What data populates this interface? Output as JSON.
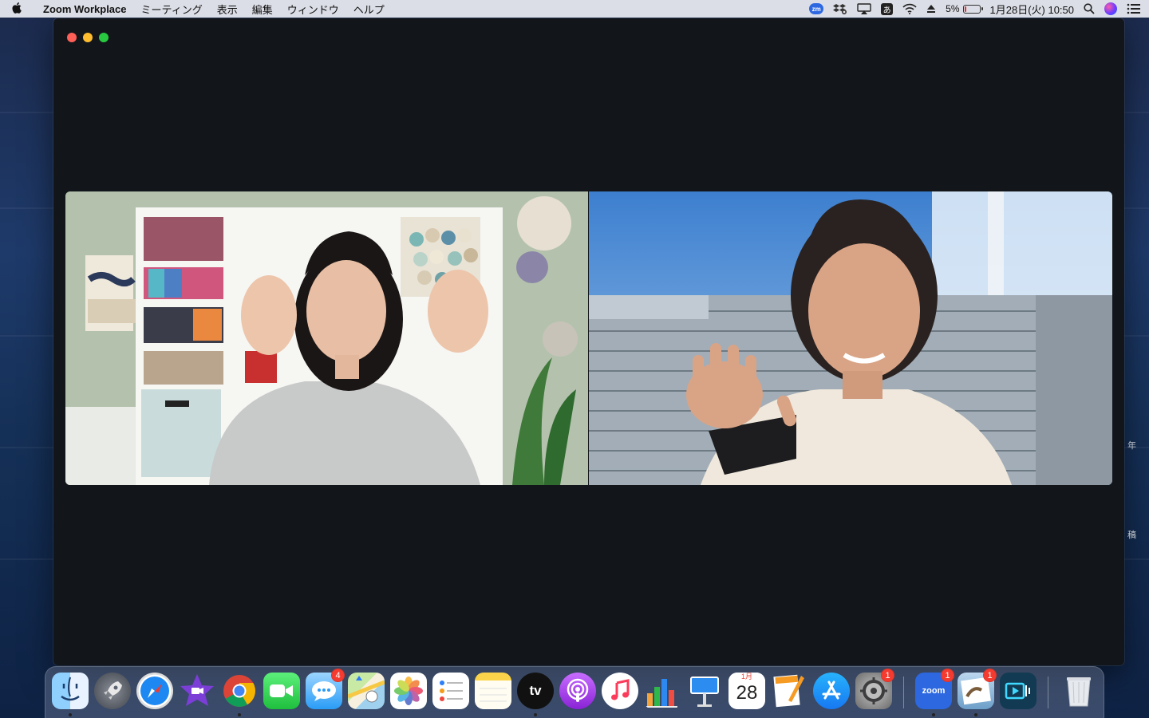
{
  "menubar": {
    "app_name": "Zoom Workplace",
    "menus": [
      "ミーティング",
      "表示",
      "編集",
      "ウィンドウ",
      "ヘルプ"
    ],
    "status": {
      "zoom_label": "zm",
      "ime_label": "あ",
      "battery_percent": "5%",
      "battery_level": 0.05,
      "datetime": "1月28日(火)  10:50"
    }
  },
  "desktop_fragments": [
    "年",
    "稿"
  ],
  "zoom_window": {
    "participants": [
      {
        "id": "participant-left"
      },
      {
        "id": "participant-right"
      }
    ]
  },
  "dock": {
    "items": [
      {
        "name": "finder",
        "running": true
      },
      {
        "name": "launchpad",
        "running": false
      },
      {
        "name": "safari",
        "running": false
      },
      {
        "name": "imovie",
        "running": false
      },
      {
        "name": "chrome",
        "running": true
      },
      {
        "name": "facetime",
        "running": false
      },
      {
        "name": "messages",
        "running": false,
        "badge": "4"
      },
      {
        "name": "maps",
        "running": false
      },
      {
        "name": "photos",
        "running": false
      },
      {
        "name": "reminders",
        "running": false
      },
      {
        "name": "notes",
        "running": false
      },
      {
        "name": "apple-tv",
        "running": true,
        "label": "tv"
      },
      {
        "name": "podcasts",
        "running": false
      },
      {
        "name": "music",
        "running": false
      },
      {
        "name": "numbers",
        "running": false
      },
      {
        "name": "keynote",
        "running": false
      },
      {
        "name": "calendar",
        "running": false,
        "month": "1月",
        "day": "28"
      },
      {
        "name": "pages",
        "running": false
      },
      {
        "name": "app-store",
        "running": false
      },
      {
        "name": "system-preferences",
        "running": false,
        "badge": "1"
      },
      {
        "name": "zoom",
        "running": true,
        "badge": "1",
        "label": "zoom"
      },
      {
        "name": "preview",
        "running": true,
        "badge": "1"
      },
      {
        "name": "video-editor",
        "running": false
      },
      {
        "name": "trash",
        "running": false
      }
    ]
  }
}
